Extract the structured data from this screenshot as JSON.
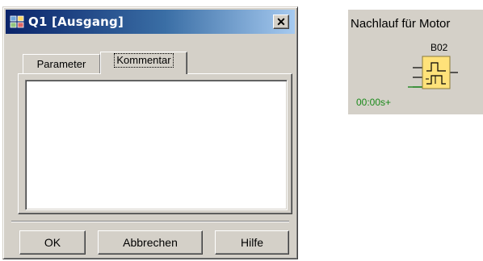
{
  "dialog": {
    "title": "Q1 [Ausgang]",
    "close_glyph": "✕",
    "tabs": [
      {
        "label": "Parameter",
        "active": false
      },
      {
        "label": "Kommentar",
        "active": true
      }
    ],
    "comment_value": "",
    "buttons": {
      "ok": "OK",
      "cancel": "Abbrechen",
      "help": "Hilfe"
    }
  },
  "function_block": {
    "title": "Nachlauf für Motor",
    "block_id": "B02",
    "parameter": "00:00s+",
    "icon": "off-delay-timer-icon",
    "colors": {
      "block_fill": "#ffe27a",
      "parameter_text": "#1a8a1a"
    }
  },
  "colors": {
    "titlebar_start": "#0a246a",
    "titlebar_end": "#a6caf0",
    "face": "#d4d0c8"
  }
}
